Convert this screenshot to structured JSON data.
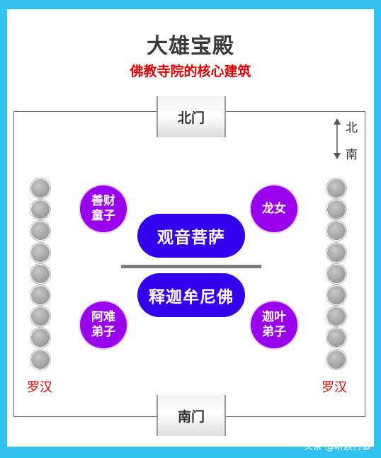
{
  "title": "大雄宝殿",
  "subtitle": "佛教寺院的核心建筑",
  "gates": {
    "north": "北门",
    "south": "南门"
  },
  "compass": {
    "north": "北",
    "south": "南"
  },
  "arhats": {
    "left_label": "罗汉",
    "right_label": "罗汉",
    "count_per_side": 9
  },
  "attendants": {
    "top_left": "善财童子",
    "top_right": "龙女",
    "bottom_left": "阿难弟子",
    "bottom_right": "迦叶弟子"
  },
  "buddhas": {
    "north": "观音菩萨",
    "south": "释迦牟尼佛"
  },
  "watermark": "头条 @昕辰行迹",
  "colors": {
    "border": "#33c1f0",
    "attendant": "#9900ee",
    "buddha": "#3300ee",
    "arhat": "#a6a6a6",
    "label_red": "#e00000"
  }
}
